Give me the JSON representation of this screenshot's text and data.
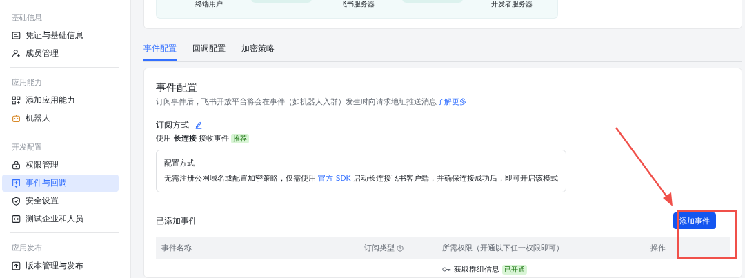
{
  "sidebar": {
    "sections": [
      {
        "title": "基础信息",
        "items": [
          {
            "label": "凭证与基础信息",
            "selected": false
          },
          {
            "label": "成员管理",
            "selected": false
          }
        ]
      },
      {
        "title": "应用能力",
        "items": [
          {
            "label": "添加应用能力",
            "selected": false
          },
          {
            "label": "机器人",
            "selected": false
          }
        ]
      },
      {
        "title": "开发配置",
        "items": [
          {
            "label": "权限管理",
            "selected": false
          },
          {
            "label": "事件与回调",
            "selected": true
          },
          {
            "label": "安全设置",
            "selected": false
          },
          {
            "label": "测试企业和人员",
            "selected": false
          }
        ]
      },
      {
        "title": "应用发布",
        "items": [
          {
            "label": "版本管理与发布",
            "selected": false
          }
        ]
      }
    ]
  },
  "diagram": {
    "nodes": [
      "终端用户",
      "飞书服务器",
      "开发者服务器"
    ]
  },
  "tabs": [
    {
      "label": "事件配置",
      "selected": true
    },
    {
      "label": "回调配置",
      "selected": false
    },
    {
      "label": "加密策略",
      "selected": false
    }
  ],
  "panel": {
    "title": "事件配置",
    "description": "订阅事件后，飞书开放平台将会在事件（如机器人入群）发生时向请求地址推送消息",
    "learn_more": "了解更多",
    "subscription": {
      "label": "订阅方式",
      "mode": "使用 **长连接** 接收事件",
      "badge": "推荐"
    },
    "config_box": {
      "title": "配置方式",
      "text_before": "无需注册公网域名或配置加密策略，仅需使用",
      "link": "官方 SDK",
      "text_after": "启动长连接飞书客户端，并确保连接成功后，即可开启该模式"
    },
    "added": {
      "title": "已添加事件",
      "button": "添加事件",
      "columns": [
        "事件名称",
        "订阅类型",
        "所需权限（开通以下任一权限即可）",
        "操作"
      ],
      "rows": [
        {
          "permission": "获取群组信息",
          "status": "已开通"
        }
      ]
    }
  }
}
